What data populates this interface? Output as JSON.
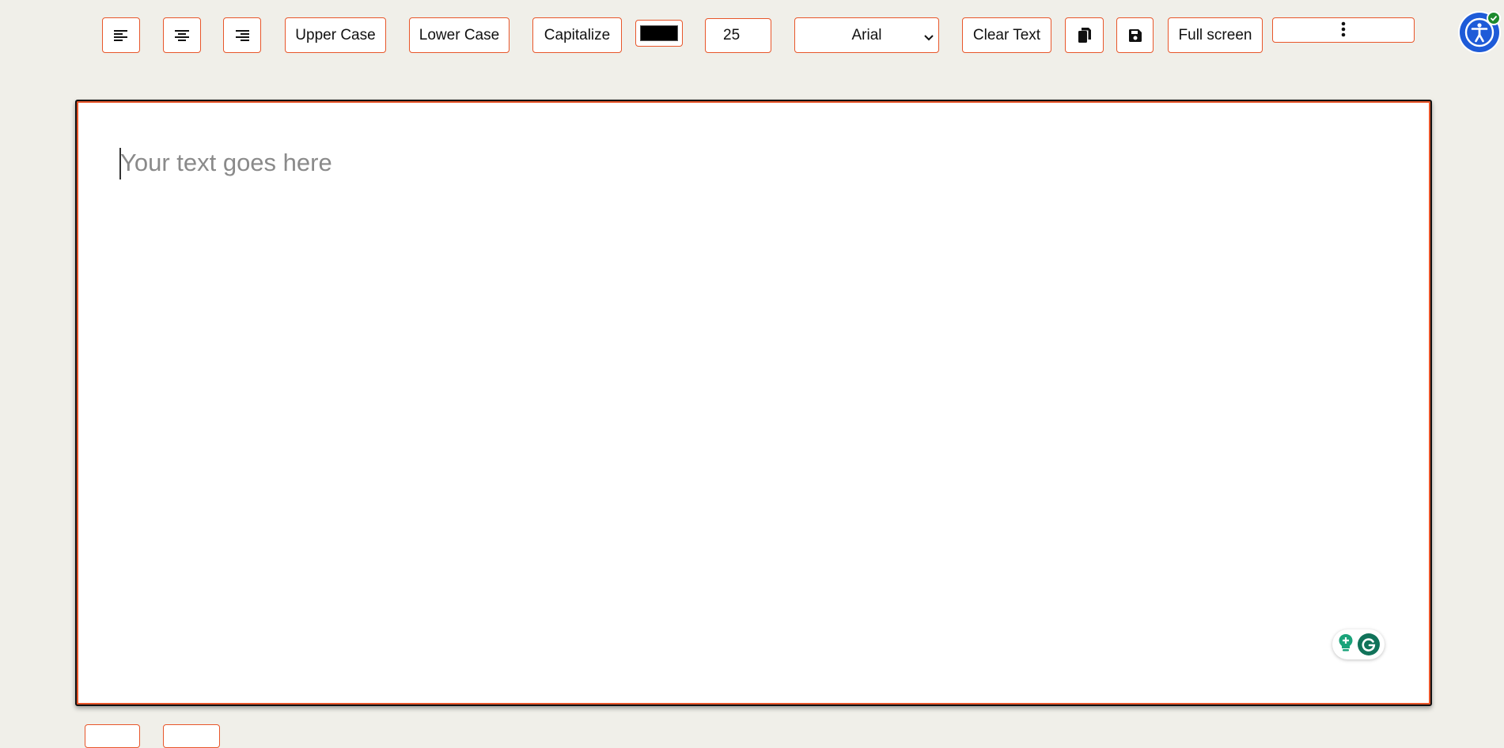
{
  "toolbar": {
    "align_left_label": "",
    "align_center_label": "",
    "align_right_label": "",
    "upper_case_label": "Upper Case",
    "lower_case_label": "Lower Case",
    "capitalize_label": "Capitalize",
    "text_color": "#000000",
    "font_size_value": "25",
    "font_family_selected": "Arial",
    "clear_text_label": "Clear Text",
    "full_screen_label": "Full screen",
    "icons": {
      "align_left": "align-left-icon",
      "align_center": "align-center-icon",
      "align_right": "align-right-icon",
      "copy": "copy-icon",
      "save": "save-icon",
      "more": "vertical-dots-icon",
      "accessibility": "accessibility-icon"
    }
  },
  "editor": {
    "placeholder": "Your text goes here",
    "value": "",
    "border_color": "#e8562a"
  },
  "colors": {
    "accent": "#e8562a",
    "background": "#f0efe9",
    "accessibility_blue": "#1e5bd8",
    "grammarly_green": "#11735a"
  }
}
